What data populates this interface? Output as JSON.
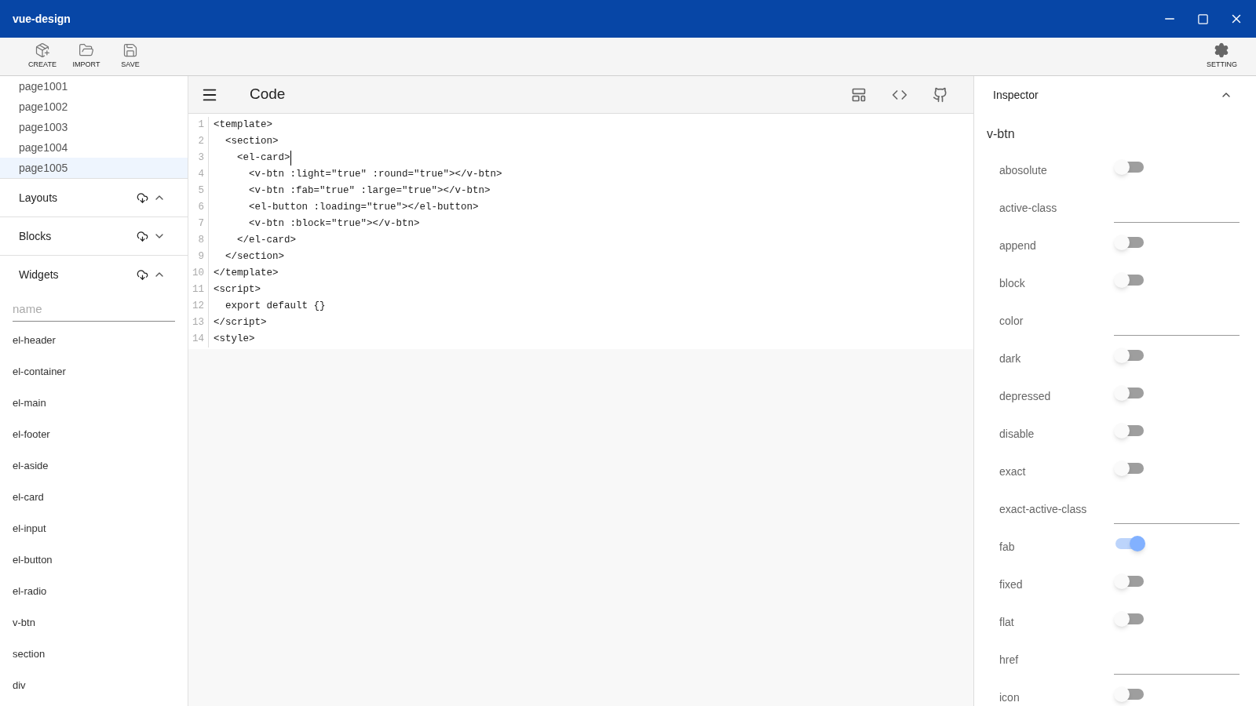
{
  "window": {
    "title": "vue-design"
  },
  "toolbar": {
    "buttons": [
      {
        "label": "CREATE",
        "kind": "create"
      },
      {
        "label": "IMPORT",
        "kind": "import"
      },
      {
        "label": "SAVE",
        "kind": "save"
      }
    ],
    "setting": {
      "label": "SETTING"
    }
  },
  "pages": [
    {
      "label": "page1001",
      "selected": false
    },
    {
      "label": "page1002",
      "selected": false
    },
    {
      "label": "page1003",
      "selected": false
    },
    {
      "label": "page1004",
      "selected": false
    },
    {
      "label": "page1005",
      "selected": true
    }
  ],
  "sections": [
    {
      "title": "Layouts",
      "expanded": true
    },
    {
      "title": "Blocks",
      "expanded": false
    },
    {
      "title": "Widgets",
      "expanded": true
    }
  ],
  "widget_search": {
    "placeholder": "name"
  },
  "widgets": [
    "el-header",
    "el-container",
    "el-main",
    "el-footer",
    "el-aside",
    "el-card",
    "el-input",
    "el-button",
    "el-radio",
    "v-btn",
    "section",
    "div"
  ],
  "editor": {
    "title": "Code",
    "lines": [
      {
        "number": "1",
        "text": "<template>",
        "cursor": false
      },
      {
        "number": "2",
        "text": "  <section>",
        "cursor": false
      },
      {
        "number": "3",
        "text": "    <el-card>",
        "cursor": true
      },
      {
        "number": "4",
        "text": "      <v-btn :light=\"true\" :round=\"true\"></v-btn>",
        "cursor": false
      },
      {
        "number": "5",
        "text": "      <v-btn :fab=\"true\" :large=\"true\"></v-btn>",
        "cursor": false
      },
      {
        "number": "6",
        "text": "      <el-button :loading=\"true\"></el-button>",
        "cursor": false
      },
      {
        "number": "7",
        "text": "      <v-btn :block=\"true\"></v-btn>",
        "cursor": false
      },
      {
        "number": "8",
        "text": "    </el-card>",
        "cursor": false
      },
      {
        "number": "9",
        "text": "  </section>",
        "cursor": false
      },
      {
        "number": "10",
        "text": "</template>",
        "cursor": false
      },
      {
        "number": "11",
        "text": "<script>",
        "cursor": false
      },
      {
        "number": "12",
        "text": "  export default {}",
        "cursor": false
      },
      {
        "number": "13",
        "text": "</script>",
        "cursor": false
      },
      {
        "number": "14",
        "text": "<style>",
        "cursor": false
      }
    ]
  },
  "inspector": {
    "title": "Inspector",
    "expanded": true,
    "component": "v-btn",
    "props": [
      {
        "label": "abosolute",
        "kind": "toggle",
        "on": false
      },
      {
        "label": "active-class",
        "kind": "text"
      },
      {
        "label": "append",
        "kind": "toggle",
        "on": false
      },
      {
        "label": "block",
        "kind": "toggle",
        "on": false
      },
      {
        "label": "color",
        "kind": "text"
      },
      {
        "label": "dark",
        "kind": "toggle",
        "on": false
      },
      {
        "label": "depressed",
        "kind": "toggle",
        "on": false
      },
      {
        "label": "disable",
        "kind": "toggle",
        "on": false
      },
      {
        "label": "exact",
        "kind": "toggle",
        "on": false
      },
      {
        "label": "exact-active-class",
        "kind": "text"
      },
      {
        "label": "fab",
        "kind": "toggle",
        "on": true
      },
      {
        "label": "fixed",
        "kind": "toggle",
        "on": false
      },
      {
        "label": "flat",
        "kind": "toggle",
        "on": false
      },
      {
        "label": "href",
        "kind": "text"
      },
      {
        "label": "icon",
        "kind": "toggle",
        "on": false
      }
    ]
  }
}
